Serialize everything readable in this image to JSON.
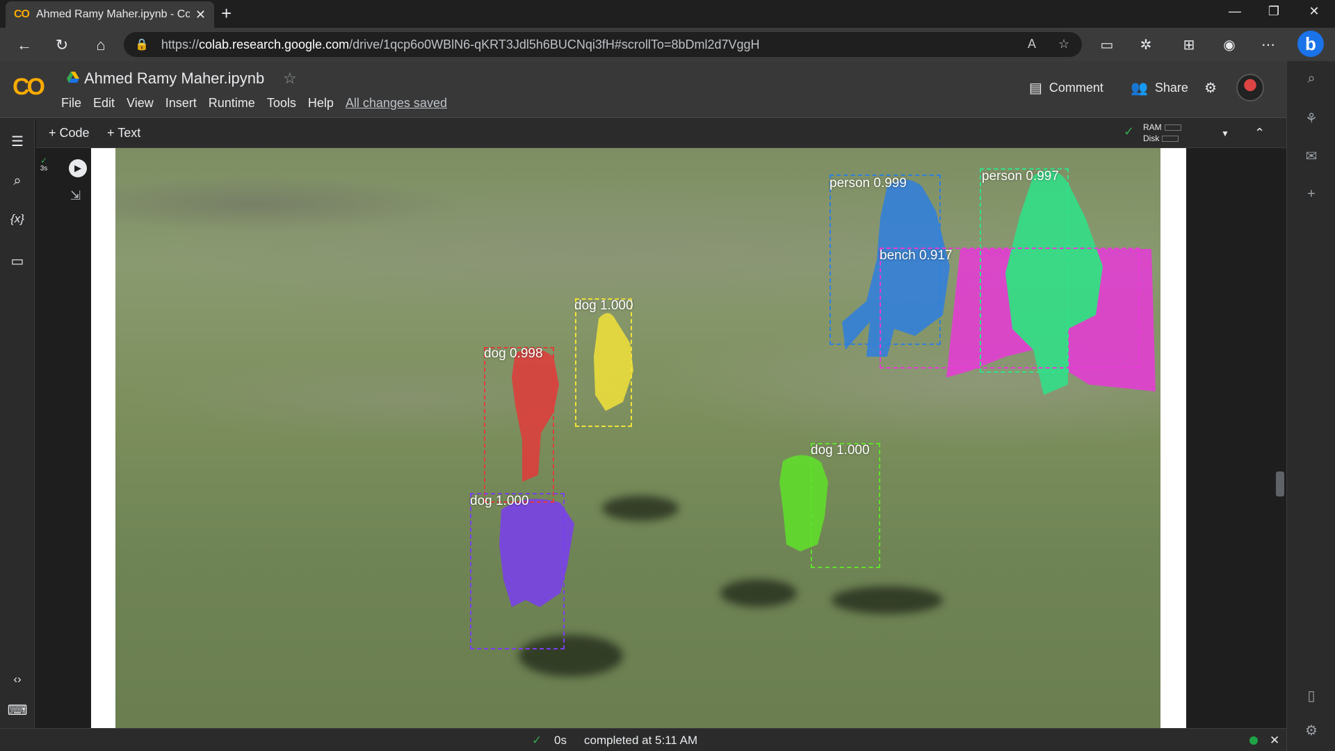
{
  "browser": {
    "tab_title": "Ahmed Ramy Maher.ipynb - Cola",
    "tab_favicon": "CO",
    "url_prefix": "https://",
    "url_host": "colab.research.google.com",
    "url_path": "/drive/1qcp6o0WBlN6-qKRT3Jdl5h6BUCNqi3fH#scrollTo=8bDml2d7VggH"
  },
  "colab": {
    "logo": "CO",
    "notebook_name": "Ahmed Ramy Maher.ipynb",
    "menu": [
      "File",
      "Edit",
      "View",
      "Insert",
      "Runtime",
      "Tools",
      "Help"
    ],
    "saved_status": "All changes saved",
    "comment_label": "Comment",
    "share_label": "Share",
    "add_code_label": "+ Code",
    "add_text_label": "+ Text",
    "ram_label": "RAM",
    "disk_label": "Disk",
    "cell_exec_time": "3s"
  },
  "detections": [
    {
      "label": "person 0.999",
      "color": "#2f7fe0"
    },
    {
      "label": "person 0.997",
      "color": "#2ee38a"
    },
    {
      "label": "bench 0.917",
      "color": "#e83ad8"
    },
    {
      "label": "dog 1.000",
      "color": "#f2e23a"
    },
    {
      "label": "dog 0.998",
      "color": "#e23b3b"
    },
    {
      "label": "dog 1.000",
      "color": "#7a3ef0"
    },
    {
      "label": "dog 1.000",
      "color": "#5fe22a"
    }
  ],
  "status": {
    "duration": "0s",
    "message": "completed at 5:11 AM"
  }
}
